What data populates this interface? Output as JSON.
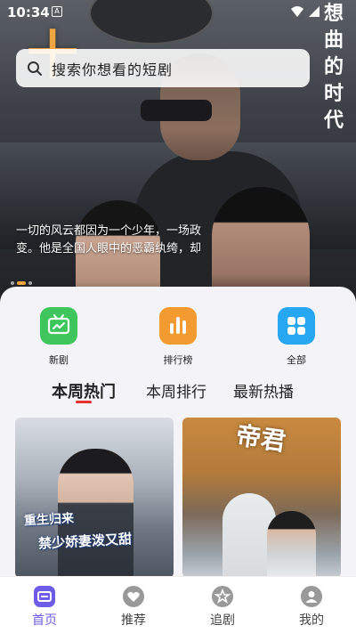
{
  "status_bar": {
    "time": "10:34",
    "app_badge": "A"
  },
  "hero": {
    "title_chars": [
      "想",
      "曲",
      "的",
      "时",
      "代"
    ],
    "orange_glyph": "十",
    "description": "一切的风云都因为一个少年，一场政变。他是全国人眼中的恶霸纨绔，却",
    "dots": 3,
    "active_dot": 1
  },
  "search": {
    "placeholder": "搜索你想看的短剧"
  },
  "quick_actions": [
    {
      "label": "新剧",
      "icon": "tv-icon",
      "color": "#3ec55c"
    },
    {
      "label": "排行榜",
      "icon": "bar-chart-icon",
      "color": "#f39b31"
    },
    {
      "label": "全部",
      "icon": "grid-icon",
      "color": "#27a7f2"
    }
  ],
  "tabs": [
    {
      "label": "本周热门",
      "active": true
    },
    {
      "label": "本周排行",
      "active": false
    },
    {
      "label": "最新热播",
      "active": false
    }
  ],
  "cards": [
    {
      "title_line1": "重生归来",
      "title_line2": "禁少娇妻泼又甜"
    },
    {
      "title": "帝君"
    }
  ],
  "nav": [
    {
      "label": "首页",
      "icon": "home-icon",
      "active": true
    },
    {
      "label": "推荐",
      "icon": "heart-icon",
      "active": false
    },
    {
      "label": "追剧",
      "icon": "star-icon",
      "active": false
    },
    {
      "label": "我的",
      "icon": "user-icon",
      "active": false
    }
  ],
  "colors": {
    "accent": "#6c5ce7",
    "tab_underline": "#e8302c"
  }
}
